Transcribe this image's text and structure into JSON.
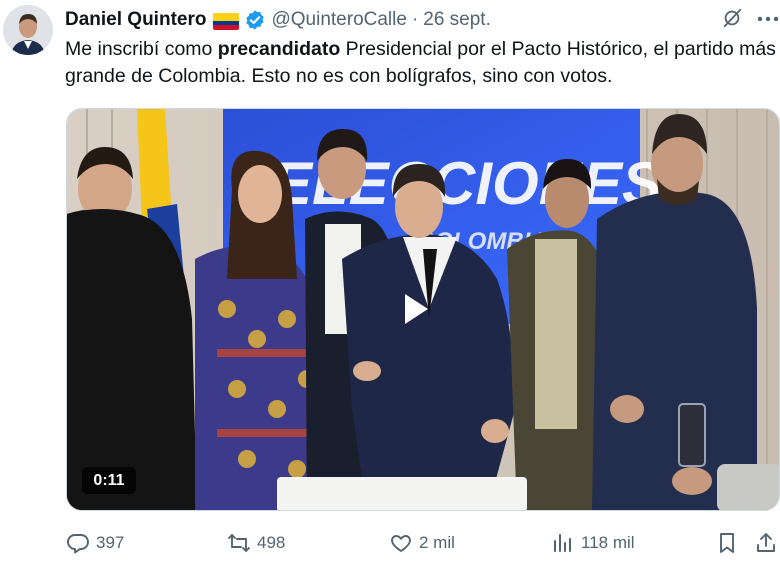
{
  "author": {
    "name": "Daniel Quintero",
    "handle": "@QuinteroCalle",
    "separator": "·",
    "date": "26 sept."
  },
  "tweet": {
    "text_before": "Me inscribí como ",
    "text_bold": "precandidato",
    "text_after": " Presidencial por el Pacto Histórico, el partido más grande de Colombia. Esto no es con bolígrafos, sino con votos."
  },
  "media": {
    "type": "video",
    "duration": "0:11",
    "backdrop_text": "ELECCIONES",
    "backdrop_subtext": "COLOMBIA"
  },
  "actions": {
    "replies": "397",
    "reposts": "498",
    "likes": "2 mil",
    "views": "118 mil"
  },
  "colors": {
    "text": "#0f1419",
    "muted": "#536471",
    "verified_blue": "#1d9bf0"
  },
  "icons": [
    "grok-icon",
    "more-icon",
    "verified-badge-icon",
    "flag-colombia-icon",
    "play-icon",
    "reply-icon",
    "repost-icon",
    "like-icon",
    "views-icon",
    "bookmark-icon",
    "share-icon"
  ]
}
